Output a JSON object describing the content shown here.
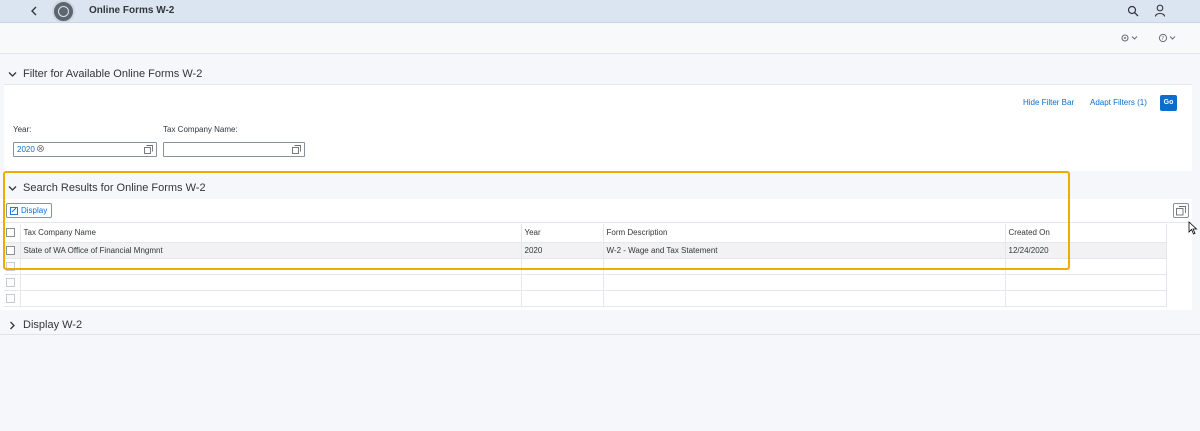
{
  "shell": {
    "title": "Online Forms W-2"
  },
  "filter": {
    "section_title": "Filter for Available Online Forms W-2",
    "hide_filter_bar": "Hide Filter Bar",
    "adapt_filters": "Adapt Filters (1)",
    "go": "Go",
    "year_label": "Year:",
    "year_token": "2020",
    "tax_company_label": "Tax Company Name:",
    "tax_company_value": ""
  },
  "results": {
    "section_title": "Search Results for Online Forms W-2",
    "display_button": "Display",
    "columns": [
      "Tax Company Name",
      "Year",
      "Form Description",
      "Created On"
    ],
    "rows": [
      {
        "company": "State of WA Office of Financial Mngmnt",
        "year": "2020",
        "description": "W-2 - Wage and Tax Statement",
        "created": "12/24/2020"
      }
    ]
  },
  "display_section": {
    "title": "Display W-2"
  },
  "colors": {
    "accent": "#0a6ed1",
    "highlight": "#f0ab00",
    "shell": "#dbe5f1"
  },
  "icons": [
    "back-icon",
    "search-icon",
    "user-icon",
    "settings-icon",
    "help-icon",
    "chevron-down-icon",
    "chevron-right-icon",
    "value-help-icon",
    "clear-token-icon",
    "display-icon",
    "table-settings-icon"
  ]
}
